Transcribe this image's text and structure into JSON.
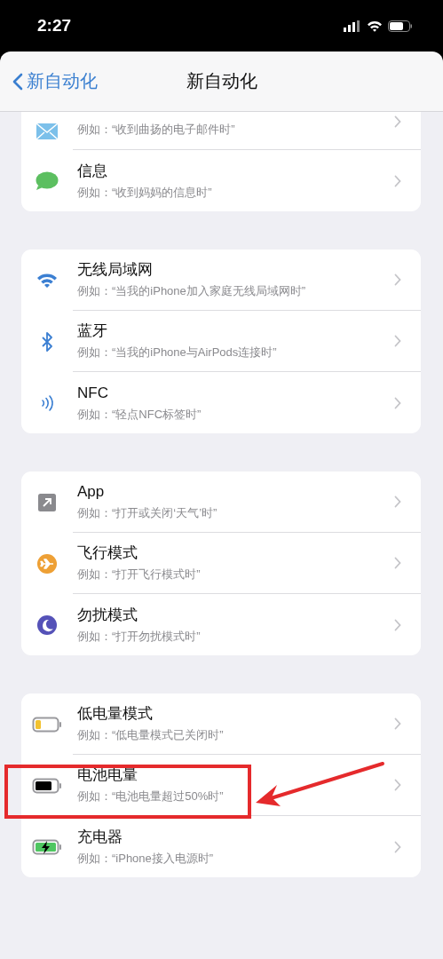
{
  "status_bar": {
    "time": "2:27"
  },
  "nav": {
    "back": "新自动化",
    "title": "新自动化"
  },
  "groups": [
    {
      "rows": [
        {
          "subtitle": "例如：“收到曲扬的电子邮件时”"
        },
        {
          "title": "信息",
          "subtitle": "例如：“收到妈妈的信息时”"
        }
      ]
    },
    {
      "rows": [
        {
          "title": "无线局域网",
          "subtitle": "例如：“当我的iPhone加入家庭无线局域网时”"
        },
        {
          "title": "蓝牙",
          "subtitle": "例如：“当我的iPhone与AirPods连接时”"
        },
        {
          "title": "NFC",
          "subtitle": "例如：“轻点NFC标签时”"
        }
      ]
    },
    {
      "rows": [
        {
          "title": "App",
          "subtitle": "例如：“打开或关闭‘天气’时”"
        },
        {
          "title": "飞行模式",
          "subtitle": "例如：“打开飞行模式时”"
        },
        {
          "title": "勿扰模式",
          "subtitle": "例如：“打开勿扰模式时”"
        }
      ]
    },
    {
      "rows": [
        {
          "title": "低电量模式",
          "subtitle": "例如：“低电量模式已关闭时”"
        },
        {
          "title": "电池电量",
          "subtitle": "例如：“电池电量超过50%时”"
        },
        {
          "title": "充电器",
          "subtitle": "例如：“iPhone接入电源时”"
        }
      ]
    }
  ]
}
